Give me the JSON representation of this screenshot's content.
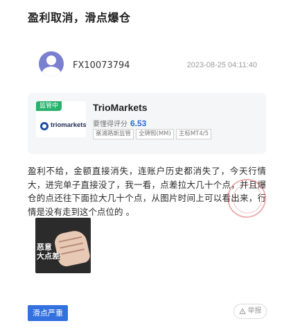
{
  "post": {
    "title": "盈利取消，滑点爆仓",
    "body": "盈利不给，金额直接消失，连账户历史都消失了，今天行情大，进完单子直接没了，我一看，点差拉大几十个点，并且爆仓的点还往下面拉大几十个点，从图片时间上可以看出来，行情是没有走到这个点位的 。"
  },
  "user": {
    "name": "FX10073794",
    "timestamp": "2023-08-25 04:11:40",
    "avatar_icon": "user-avatar-icon"
  },
  "broker": {
    "regulation_tag": "监管中",
    "logo_text": "triomarkets",
    "name": "TrioMarkets",
    "rating_label": "要懂得评分",
    "rating_value": "6.53",
    "tags": [
      "塞浦路斯监管",
      "全牌照(MM)",
      "主标MT4/5"
    ]
  },
  "attachment": {
    "caption": "恶意\n大点差"
  },
  "actions": {
    "expose_label": "滑点严重",
    "report_label": "举报"
  },
  "colors": {
    "accent": "#3370e0",
    "regulated": "#27b36b",
    "rating": "#2d6fd6"
  }
}
